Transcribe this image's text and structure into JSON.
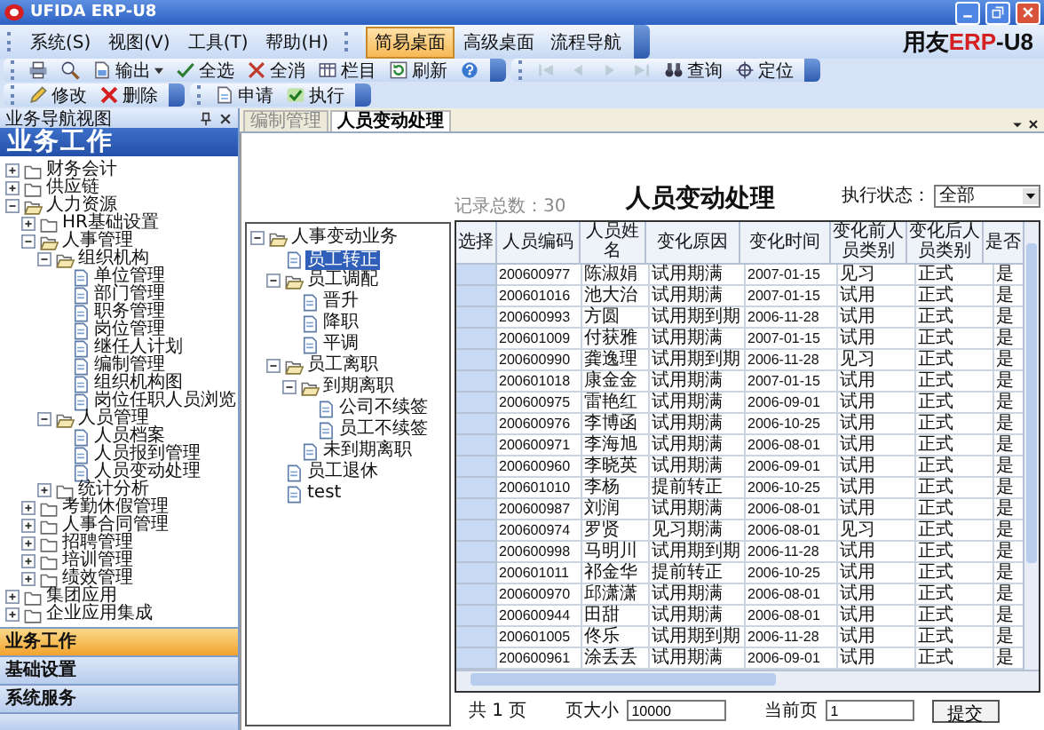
{
  "window": {
    "title": "UFIDA ERP-U8"
  },
  "brand": [
    {
      "text": "用友",
      "kind": "plain"
    },
    {
      "text": "ERP",
      "kind": "accent"
    },
    {
      "text": "-U8",
      "kind": "plain"
    }
  ],
  "menu": [
    {
      "label": "系统(S)"
    },
    {
      "label": "视图(V)"
    },
    {
      "label": "工具(T)"
    },
    {
      "label": "帮助(H)"
    }
  ],
  "desktop_tabs": [
    {
      "label": "简易桌面",
      "selected": true
    },
    {
      "label": "高级桌面",
      "selected": false
    },
    {
      "label": "流程导航",
      "selected": false
    }
  ],
  "toolbar_rows": [
    {
      "groups": [
        {
          "items": [
            {
              "kind": "print",
              "disabled": false
            },
            {
              "kind": "preview",
              "disabled": false
            },
            {
              "kind": "export",
              "label": "输出",
              "disabled": false
            },
            {
              "kind": "select_all",
              "label": "全选",
              "disabled": false
            },
            {
              "kind": "deselect",
              "label": "全消",
              "disabled": false
            },
            {
              "kind": "columns",
              "label": "栏目",
              "disabled": false
            },
            {
              "kind": "refresh",
              "label": "刷新",
              "disabled": false
            },
            {
              "kind": "help",
              "disabled": false
            }
          ]
        },
        {
          "items": [
            {
              "kind": "first",
              "disabled": true
            },
            {
              "kind": "prev",
              "disabled": true
            },
            {
              "kind": "next",
              "disabled": true
            },
            {
              "kind": "last",
              "disabled": true
            },
            {
              "kind": "query",
              "label": "查询",
              "disabled": false
            },
            {
              "kind": "locate",
              "label": "定位",
              "disabled": false
            }
          ]
        }
      ]
    },
    {
      "groups": [
        {
          "items": [
            {
              "kind": "edit",
              "label": "修改",
              "disabled": false
            },
            {
              "kind": "delete",
              "label": "删除",
              "disabled": false
            }
          ]
        },
        {
          "items": [
            {
              "kind": "apply",
              "label": "申请",
              "disabled": false
            },
            {
              "kind": "execute",
              "label": "执行",
              "disabled": false
            }
          ]
        }
      ]
    }
  ],
  "nav_panel": {
    "title": "业务导航视图",
    "heading": "业务工作",
    "tree": [
      {
        "label": "财务会计",
        "kind": "folder",
        "expanded": false
      },
      {
        "label": "供应链",
        "kind": "folder",
        "expanded": false
      },
      {
        "label": "人力资源",
        "kind": "folder",
        "expanded": true,
        "children": [
          {
            "label": "HR基础设置",
            "kind": "folder",
            "expanded": false
          },
          {
            "label": "人事管理",
            "kind": "folder",
            "expanded": true,
            "children": [
              {
                "label": "组织机构",
                "kind": "folder",
                "expanded": true,
                "children": [
                  {
                    "label": "单位管理",
                    "kind": "doc"
                  },
                  {
                    "label": "部门管理",
                    "kind": "doc"
                  },
                  {
                    "label": "职务管理",
                    "kind": "doc"
                  },
                  {
                    "label": "岗位管理",
                    "kind": "doc"
                  },
                  {
                    "label": "继任人计划",
                    "kind": "doc"
                  },
                  {
                    "label": "编制管理",
                    "kind": "doc"
                  },
                  {
                    "label": "组织机构图",
                    "kind": "doc"
                  },
                  {
                    "label": "岗位任职人员浏览",
                    "kind": "doc"
                  }
                ]
              },
              {
                "label": "人员管理",
                "kind": "folder",
                "expanded": true,
                "children": [
                  {
                    "label": "人员档案",
                    "kind": "doc"
                  },
                  {
                    "label": "人员报到管理",
                    "kind": "doc"
                  },
                  {
                    "label": "人员变动处理",
                    "kind": "doc"
                  }
                ]
              },
              {
                "label": "统计分析",
                "kind": "folder",
                "expanded": false
              }
            ]
          },
          {
            "label": "考勤休假管理",
            "kind": "folder",
            "expanded": false
          },
          {
            "label": "人事合同管理",
            "kind": "folder",
            "expanded": false
          },
          {
            "label": "招聘管理",
            "kind": "folder",
            "expanded": false
          },
          {
            "label": "培训管理",
            "kind": "folder",
            "expanded": false
          },
          {
            "label": "绩效管理",
            "kind": "folder",
            "expanded": false
          }
        ]
      },
      {
        "label": "集团应用",
        "kind": "folder",
        "expanded": false
      },
      {
        "label": "企业应用集成",
        "kind": "folder",
        "expanded": false
      }
    ],
    "sections": [
      {
        "label": "业务工作",
        "selected": true
      },
      {
        "label": "基础设置",
        "selected": false
      },
      {
        "label": "系统服务",
        "selected": false
      }
    ]
  },
  "tabs": [
    {
      "label": "编制管理",
      "selected": false
    },
    {
      "label": "人员变动处理",
      "selected": true
    }
  ],
  "category_tree": [
    {
      "label": "人事变动业务",
      "kind": "folder",
      "expanded": true,
      "selected": false,
      "children": [
        {
          "label": "员工转正",
          "kind": "doc",
          "selected": true
        },
        {
          "label": "员工调配",
          "kind": "folder",
          "expanded": true,
          "selected": false,
          "children": [
            {
              "label": "晋升",
              "kind": "doc",
              "selected": false
            },
            {
              "label": "降职",
              "kind": "doc",
              "selected": false
            },
            {
              "label": "平调",
              "kind": "doc",
              "selected": false
            }
          ]
        },
        {
          "label": "员工离职",
          "kind": "folder",
          "expanded": true,
          "selected": false,
          "children": [
            {
              "label": "到期离职",
              "kind": "folder",
              "expanded": true,
              "selected": false,
              "children": [
                {
                  "label": "公司不续签",
                  "kind": "doc",
                  "selected": false
                },
                {
                  "label": "员工不续签",
                  "kind": "doc",
                  "selected": false
                }
              ]
            },
            {
              "label": "未到期离职",
              "kind": "doc",
              "selected": false
            }
          ]
        },
        {
          "label": "员工退休",
          "kind": "doc",
          "selected": false
        },
        {
          "label": "test",
          "kind": "doc",
          "selected": false
        }
      ]
    }
  ],
  "page": {
    "title": "人员变动处理",
    "record_count": "记录总数：30",
    "status_label": "执行状态：",
    "status_value": "全部"
  },
  "table": {
    "columns": [
      "选择",
      "人员编码",
      "人员姓名",
      "变化原因",
      "变化时间",
      "变化前人员类别",
      "变化后人员类别",
      "是否"
    ],
    "rows": [
      [
        "",
        "200600977",
        "陈淑娟",
        "试用期满",
        "2007-01-15",
        "见习",
        "正式",
        "是"
      ],
      [
        "",
        "200601016",
        "池大治",
        "试用期满",
        "2007-01-15",
        "试用",
        "正式",
        "是"
      ],
      [
        "",
        "200600993",
        "方圆",
        "试用期到期",
        "2006-11-28",
        "试用",
        "正式",
        "是"
      ],
      [
        "",
        "200601009",
        "付获雅",
        "试用期满",
        "2007-01-15",
        "试用",
        "正式",
        "是"
      ],
      [
        "",
        "200600990",
        "龚逸理",
        "试用期到期",
        "2006-11-28",
        "见习",
        "正式",
        "是"
      ],
      [
        "",
        "200601018",
        "康金金",
        "试用期满",
        "2007-01-15",
        "试用",
        "正式",
        "是"
      ],
      [
        "",
        "200600975",
        "雷艳红",
        "试用期满",
        "2006-09-01",
        "试用",
        "正式",
        "是"
      ],
      [
        "",
        "200600976",
        "李博函",
        "试用期满",
        "2006-10-25",
        "试用",
        "正式",
        "是"
      ],
      [
        "",
        "200600971",
        "李海旭",
        "试用期满",
        "2006-08-01",
        "试用",
        "正式",
        "是"
      ],
      [
        "",
        "200600960",
        "李晓英",
        "试用期满",
        "2006-09-01",
        "试用",
        "正式",
        "是"
      ],
      [
        "",
        "200601010",
        "李杨",
        "提前转正",
        "2006-10-25",
        "试用",
        "正式",
        "是"
      ],
      [
        "",
        "200600987",
        "刘润",
        "试用期满",
        "2006-08-01",
        "试用",
        "正式",
        "是"
      ],
      [
        "",
        "200600974",
        "罗贤",
        "见习期满",
        "2006-08-01",
        "见习",
        "正式",
        "是"
      ],
      [
        "",
        "200600998",
        "马明川",
        "试用期到期",
        "2006-11-28",
        "试用",
        "正式",
        "是"
      ],
      [
        "",
        "200601011",
        "祁金华",
        "提前转正",
        "2006-10-25",
        "试用",
        "正式",
        "是"
      ],
      [
        "",
        "200600970",
        "邱潇潇",
        "试用期满",
        "2006-08-01",
        "试用",
        "正式",
        "是"
      ],
      [
        "",
        "200600944",
        "田甜",
        "试用期满",
        "2006-08-01",
        "试用",
        "正式",
        "是"
      ],
      [
        "",
        "200601005",
        "佟乐",
        "试用期到期",
        "2006-11-28",
        "试用",
        "正式",
        "是"
      ],
      [
        "",
        "200600961",
        "涂丢丢",
        "试用期满",
        "2006-09-01",
        "试用",
        "正式",
        "是"
      ]
    ]
  },
  "footer": {
    "pages": "共 1 页",
    "page_size_label": "页大小",
    "page_size": "10000",
    "current_page_label": "当前页",
    "current_page": "1",
    "submit": "提交"
  }
}
